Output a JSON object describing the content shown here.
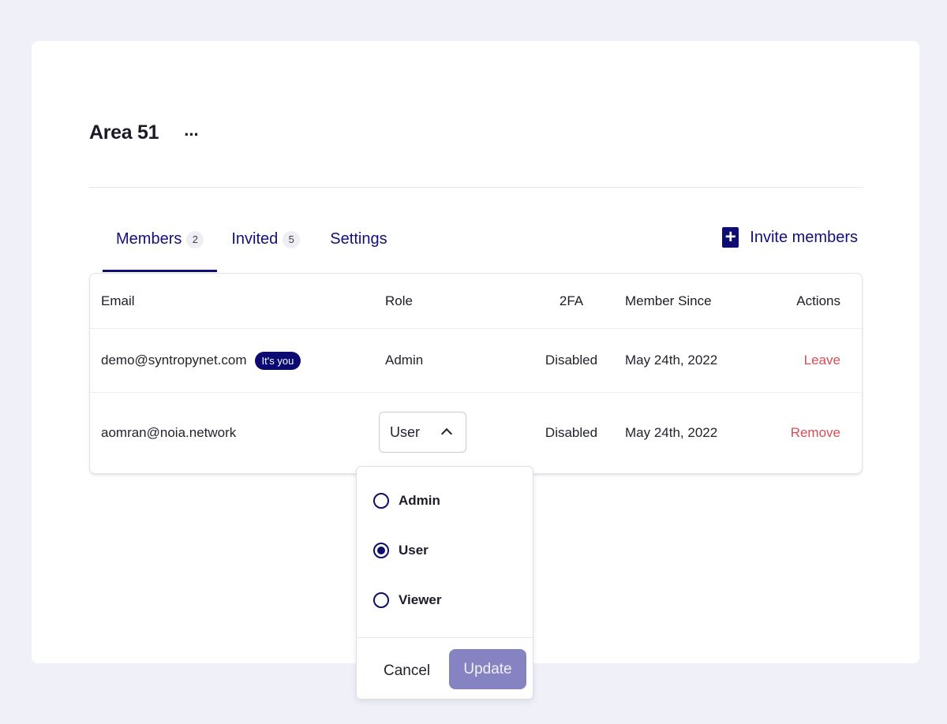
{
  "org": {
    "title": "Area 51",
    "more_label": "..."
  },
  "tabs": [
    {
      "label": "Members",
      "count": "2"
    },
    {
      "label": "Invited",
      "count": "5"
    },
    {
      "label": "Settings"
    }
  ],
  "invite": {
    "icon": "plus-icon",
    "label": "Invite members"
  },
  "table": {
    "headers": {
      "email": "Email",
      "role": "Role",
      "twofa": "2FA",
      "since": "Member Since",
      "actions": "Actions"
    },
    "rows": [
      {
        "email": "demo@syntropynet.com",
        "badge": "It's you",
        "role": "Admin",
        "twofa": "Disabled",
        "since": "May 24th, 2022",
        "action": "Leave"
      },
      {
        "email": "aomran@noia.network",
        "role": "User",
        "twofa": "Disabled",
        "since": "May 24th, 2022",
        "action": "Remove"
      }
    ]
  },
  "role_dropdown": {
    "options": [
      {
        "label": "Admin",
        "selected": false
      },
      {
        "label": "User",
        "selected": true
      },
      {
        "label": "Viewer",
        "selected": false
      }
    ],
    "cancel_label": "Cancel",
    "update_label": "Update"
  },
  "colors": {
    "accent": "#0d0d74",
    "danger": "#d64d57",
    "update_disabled": "#8583c2",
    "background": "#eff0f8"
  }
}
